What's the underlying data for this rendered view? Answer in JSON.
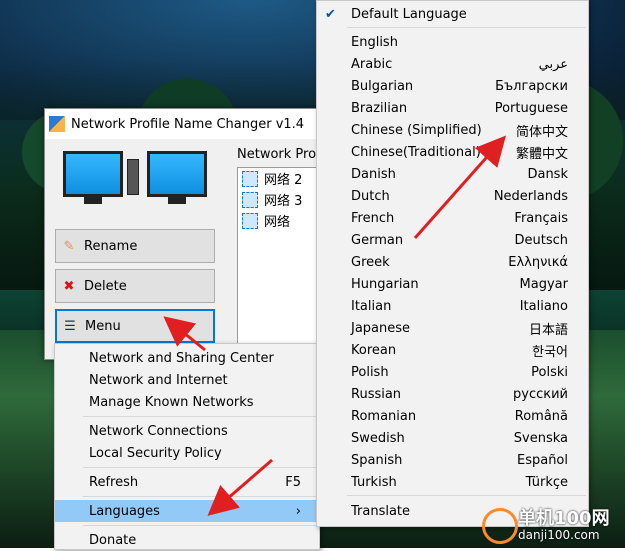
{
  "window": {
    "title": "Network Profile Name Changer v1.4",
    "list_header": "Network Prof",
    "networks": [
      "网络 2",
      "网络 3",
      "网络"
    ],
    "buttons": {
      "rename": "Rename",
      "delete": "Delete",
      "menu": "Menu"
    }
  },
  "menu": {
    "items": [
      "Network and Sharing Center",
      "Network and Internet",
      "Manage Known Networks",
      "Network Connections",
      "Local Security Policy",
      "Refresh",
      "Languages",
      "Donate"
    ],
    "refresh_shortcut": "F5",
    "submenu_arrow": "›"
  },
  "languages": {
    "default": "Default Language",
    "check": "✔",
    "list": [
      {
        "name": "English",
        "native": ""
      },
      {
        "name": "Arabic",
        "native": "عربي"
      },
      {
        "name": "Bulgarian",
        "native": "Български"
      },
      {
        "name": "Brazilian",
        "native": "Portuguese"
      },
      {
        "name": "Chinese (Simplified)",
        "native": "简体中文"
      },
      {
        "name": "Chinese(Traditional)",
        "native": "繁體中文"
      },
      {
        "name": "Danish",
        "native": "Dansk"
      },
      {
        "name": "Dutch",
        "native": "Nederlands"
      },
      {
        "name": "French",
        "native": "Français"
      },
      {
        "name": "German",
        "native": "Deutsch"
      },
      {
        "name": "Greek",
        "native": "Ελληνικά"
      },
      {
        "name": "Hungarian",
        "native": "Magyar"
      },
      {
        "name": "Italian",
        "native": "Italiano"
      },
      {
        "name": "Japanese",
        "native": "日本語"
      },
      {
        "name": "Korean",
        "native": "한국어"
      },
      {
        "name": "Polish",
        "native": "Polski"
      },
      {
        "name": "Russian",
        "native": "русский"
      },
      {
        "name": "Romanian",
        "native": "Română"
      },
      {
        "name": "Swedish",
        "native": "Svenska"
      },
      {
        "name": "Spanish",
        "native": "Español"
      },
      {
        "name": "Turkish",
        "native": "Türkçe"
      }
    ],
    "translate": "Translate"
  },
  "watermark": {
    "brand": "单机100网",
    "url": "danji100.com"
  },
  "colors": {
    "highlight": "#91c9f7",
    "arrow": "#e02020",
    "accent": "#0078d7"
  }
}
